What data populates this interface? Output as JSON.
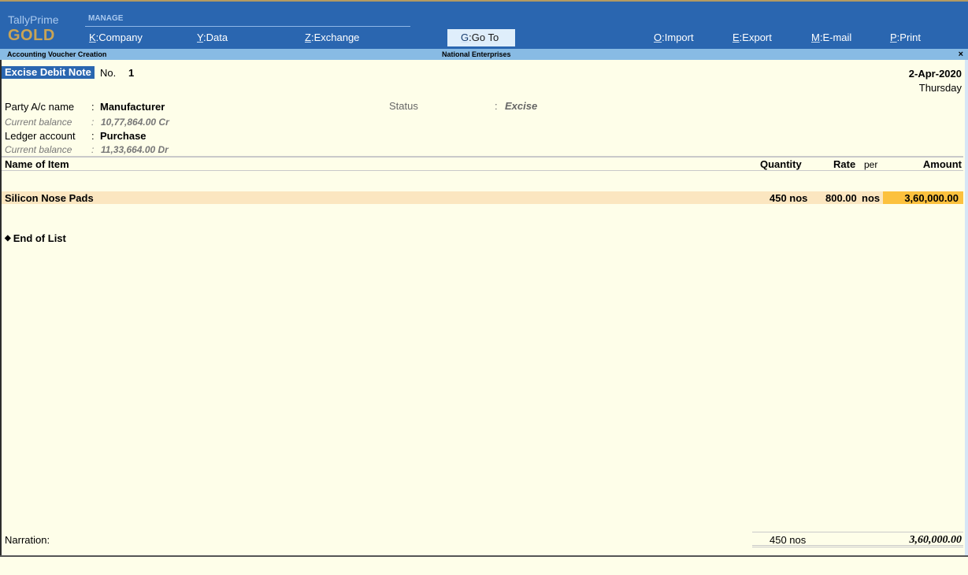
{
  "brand": {
    "name": "TallyPrime",
    "edition": "GOLD"
  },
  "topmenu": {
    "section_label": "MANAGE",
    "items": [
      {
        "key": "K",
        "label": "Company"
      },
      {
        "key": "Y",
        "label": "Data"
      },
      {
        "key": "Z",
        "label": "Exchange"
      },
      {
        "key": "G",
        "label": "Go To"
      },
      {
        "key": "O",
        "label": "Import"
      },
      {
        "key": "E",
        "label": "Export"
      },
      {
        "key": "M",
        "label": "E-mail"
      },
      {
        "key": "P",
        "label": "Print"
      }
    ]
  },
  "titlebar": {
    "screen_title": "Accounting Voucher  Creation",
    "company": "National Enterprises",
    "close": "×"
  },
  "voucher": {
    "type": "Excise Debit Note",
    "no_label": "No.",
    "no_value": "1",
    "date": "2-Apr-2020",
    "day": "Thursday"
  },
  "fields": {
    "party_label": "Party A/c name",
    "party_value": "Manufacturer",
    "party_balance_label": "Current balance",
    "party_balance_value": "10,77,864.00 Cr",
    "ledger_label": "Ledger account",
    "ledger_value": "Purchase",
    "ledger_balance_label": "Current balance",
    "ledger_balance_value": "11,33,664.00 Dr",
    "status_label": "Status",
    "status_value": "Excise",
    "colon": ":"
  },
  "table": {
    "headers": {
      "name": "Name of Item",
      "quantity": "Quantity",
      "rate": "Rate",
      "per": "per",
      "amount": "Amount"
    },
    "rows": [
      {
        "name": "Silicon Nose  Pads",
        "quantity": "450 nos",
        "rate": "800.00",
        "per": "nos",
        "amount": "3,60,000.00"
      }
    ],
    "end_of_list": "End of List"
  },
  "footer": {
    "narration_label": "Narration:",
    "total_quantity": "450 nos",
    "total_amount": "3,60,000.00"
  },
  "colors": {
    "accent": "#2a66b0",
    "background": "#fefee9",
    "highlight_row": "#fbe6c0",
    "highlight_cell": "#fcc13e"
  }
}
